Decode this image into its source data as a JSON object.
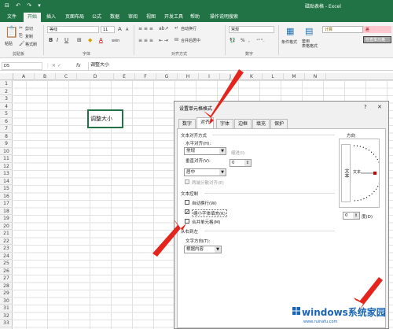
{
  "app": {
    "title": "磁贴表格 - Excel",
    "quick_access": "⊟ ↶ ↷ ▾"
  },
  "tabs": [
    "文件",
    "开始",
    "插入",
    "页面布局",
    "公式",
    "数据",
    "审阅",
    "视图",
    "开发工具",
    "帮助",
    "操作说明搜索"
  ],
  "ribbon": {
    "clipboard": {
      "cut": "剪切",
      "copy": "复制",
      "painter": "格式刷",
      "paste": "粘贴",
      "group": "剪贴板"
    },
    "font": {
      "name": "等线",
      "size": "11",
      "group": "字体",
      "bold": "B",
      "italic": "I",
      "underline": "U",
      "grow": "A",
      "shrink": "A",
      "color_letter": "A",
      "wen": "wén"
    },
    "alignment": {
      "wrap": "自动换行",
      "merge": "合并后居中",
      "group": "对齐方式"
    },
    "number": {
      "format": "常规",
      "group": "数字",
      "pct": "%",
      "comma": ","
    },
    "styles": {
      "cond": "条件格式",
      "table": "套用\n表格格式",
      "bad": "差",
      "calc": "计算",
      "check": "检查单元格"
    }
  },
  "formula_bar": {
    "name_box": "D5",
    "fx": "fx",
    "content": "调整大小"
  },
  "columns": [
    "A",
    "B",
    "C",
    "D",
    "E",
    "F",
    "G",
    "H",
    "I",
    "J",
    "K",
    "L",
    "M",
    "N"
  ],
  "rows": [
    "1",
    "2",
    "3",
    "4",
    "5",
    "6",
    "7",
    "8",
    "9",
    "10",
    "11",
    "12",
    "13",
    "14",
    "15",
    "16",
    "17",
    "18",
    "19",
    "20",
    "21",
    "22",
    "23",
    "24",
    "25",
    "26",
    "27",
    "28",
    "29",
    "30",
    "31",
    "32",
    "33"
  ],
  "cell": {
    "ref": "D5",
    "value": "调整大小"
  },
  "dialog": {
    "title": "设置单元格格式",
    "help": "?",
    "close": "✕",
    "tabs": [
      "数字",
      "对齐",
      "字体",
      "边框",
      "填充",
      "保护"
    ],
    "active_tab": "对齐",
    "text_align_section": "文本对齐方式",
    "h_align_label": "水平对齐(H):",
    "h_align_value": "常规",
    "indent_label": "缩进(I):",
    "indent_value": "0",
    "v_align_label": "垂直对齐(V):",
    "v_align_value": "居中",
    "justify_distributed": "两端分散对齐(E)",
    "text_control_section": "文本控制",
    "wrap_text": "自动换行(W)",
    "shrink_to_fit": "缩小字体填充(K)",
    "merge_cells": "合并单元格(M)",
    "shrink_checked": "✓",
    "rtl_section": "从右到左",
    "text_direction_label": "文字方向(T):",
    "text_direction_value": "根据内容",
    "orientation_label": "方向",
    "orient_vertical": "文本",
    "orient_horizontal": "文本",
    "degree_value": "0",
    "degree_label": "度(D)"
  },
  "watermark": {
    "brand": "windows系统家园",
    "url": "www.ruinafu.com"
  },
  "colors": {
    "excel_green": "#217346",
    "arrow_red": "#e4251e"
  }
}
